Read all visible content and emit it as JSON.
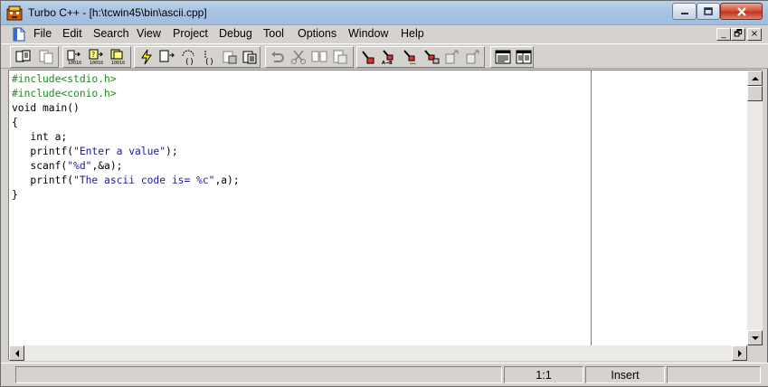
{
  "window": {
    "title": "Turbo C++ - [h:\\tcwin45\\bin\\ascii.cpp]",
    "caption_buttons": {
      "minimize": "minimize-icon",
      "maximize": "maximize-icon",
      "close": "close-icon"
    }
  },
  "menu": {
    "items": [
      "File",
      "Edit",
      "Search",
      "View",
      "Project",
      "Debug",
      "Tool",
      "Options",
      "Window",
      "Help"
    ],
    "mdi_buttons": {
      "minimize": "_",
      "restore": "🗗",
      "close": "×"
    }
  },
  "toolbar": {
    "buttons": [
      "open-project-icon",
      "save-icon",
      "compile-icon",
      "make-icon",
      "build-all-icon",
      "run-icon",
      "step-over-icon",
      "trace-into-icon",
      "go-to-cursor-icon",
      "toggle-breakpoint-icon",
      "inspect-icon",
      "undo-icon",
      "cut-icon",
      "copy-icon",
      "paste-icon",
      "search-icon",
      "replace-icon",
      "search-again-icon",
      "browse-symbol-icon",
      "previous-icon",
      "next-icon",
      "message-window-icon",
      "project-window-icon"
    ]
  },
  "editor": {
    "lines": [
      [
        {
          "t": "#include<stdio.h>",
          "c": "pp"
        }
      ],
      [
        {
          "t": "#include<conio.h>",
          "c": "pp"
        }
      ],
      [
        {
          "t": "void main()",
          "c": ""
        }
      ],
      [
        {
          "t": "{",
          "c": ""
        }
      ],
      [
        {
          "t": "   int a;",
          "c": ""
        }
      ],
      [
        {
          "t": "   printf(",
          "c": ""
        },
        {
          "t": "\"Enter a value\"",
          "c": "str"
        },
        {
          "t": ");",
          "c": ""
        }
      ],
      [
        {
          "t": "   scanf(",
          "c": ""
        },
        {
          "t": "\"%d\"",
          "c": "str"
        },
        {
          "t": ",&a);",
          "c": ""
        }
      ],
      [
        {
          "t": "   printf(",
          "c": ""
        },
        {
          "t": "\"The ascii code is= %c\"",
          "c": "str"
        },
        {
          "t": ",a);",
          "c": ""
        }
      ],
      [
        {
          "t": "}",
          "c": ""
        }
      ]
    ],
    "colors": {
      "preprocessor": "#1e8a1e",
      "string": "#1a1aa6",
      "text": "#000000"
    }
  },
  "status": {
    "message": "",
    "position": "1:1",
    "mode": "Insert"
  }
}
